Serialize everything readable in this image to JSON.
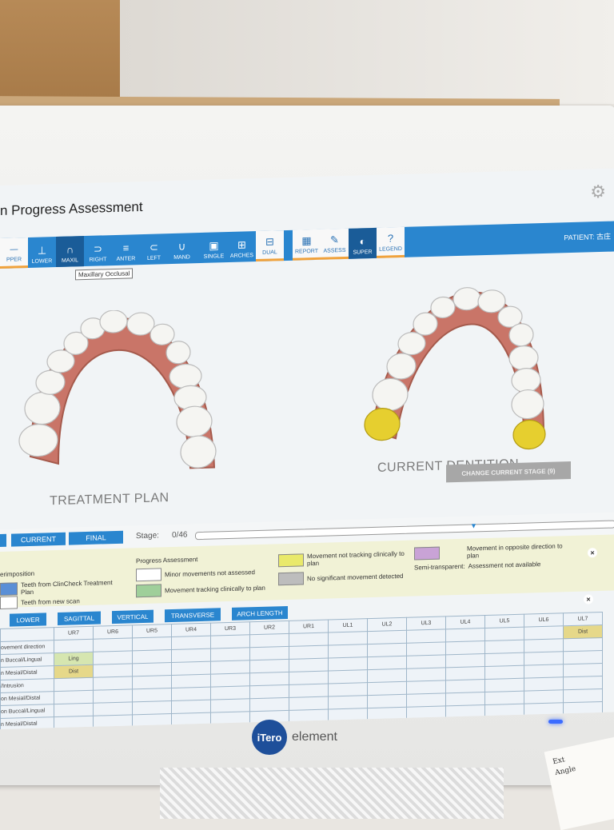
{
  "app": {
    "title": "n Progress Assessment",
    "patient_label": "PATIENT: 古庄",
    "tooltip": "Maxillary Occlusal"
  },
  "toolbar": {
    "view_buttons": [
      {
        "label": "PPER",
        "icon": "upper-icon"
      },
      {
        "label": "LOWER",
        "icon": "lower-icon"
      },
      {
        "label": "MAXIL",
        "icon": "maxil-icon"
      },
      {
        "label": "RIGHT",
        "icon": "right-icon"
      },
      {
        "label": "ANTER",
        "icon": "anterior-icon"
      },
      {
        "label": "LEFT",
        "icon": "left-icon"
      },
      {
        "label": "MAND",
        "icon": "mand-icon"
      }
    ],
    "layout_buttons": [
      {
        "label": "SINGLE",
        "icon": "single-icon"
      },
      {
        "label": "ARCHES",
        "icon": "arches-icon"
      }
    ],
    "dual_label": "DUAL",
    "tool_buttons": [
      {
        "label": "REPORT",
        "icon": "report-icon"
      },
      {
        "label": "ASSESS",
        "icon": "assess-icon"
      },
      {
        "label": "SUPER",
        "icon": "super-icon"
      },
      {
        "label": "LEGEND",
        "icon": "legend-icon"
      }
    ]
  },
  "viewer": {
    "left_label": "TREATMENT PLAN",
    "right_label": "CURRENT DENTITION",
    "change_stage_label": "CHANGE CURRENT STAGE (9)"
  },
  "timeline": {
    "current_label": "CURRENT",
    "final_label": "FINAL",
    "stage_label": "Stage:",
    "stage_value": "0/46"
  },
  "legend": {
    "superimposition_title": "erimposition",
    "teeth_clincheck": "Teeth from ClinCheck Treatment Plan",
    "teeth_new_scan": "Teeth from new scan",
    "progress_title": "Progress Assessment",
    "minor_movements": "Minor movements not assessed",
    "tracking": "Movement tracking clinically to plan",
    "not_tracking": "Movement not tracking clinically to plan",
    "no_significant": "No significant movement detected",
    "opposite": "Movement in opposite direction to plan",
    "semi_transparent": "Semi-transparent:",
    "not_available": "Assessment not available",
    "colors": {
      "clincheck": "#5a8fd6",
      "new_scan": "#ffffff",
      "minor": "#ffffff",
      "tracking": "#9fcf9a",
      "not_tracking": "#e9e96a",
      "no_significant": "#bdbdbd",
      "opposite": "#c9a3d6"
    }
  },
  "table": {
    "tabs": [
      "LOWER",
      "SAGITTAL",
      "VERTICAL",
      "TRANSVERSE",
      "ARCH LENGTH"
    ],
    "columns": [
      "UR7",
      "UR6",
      "UR5",
      "UR4",
      "UR3",
      "UR2",
      "UR1",
      "UL1",
      "UL2",
      "UL3",
      "UL4",
      "UL5",
      "UL6",
      "UL7"
    ],
    "rows": [
      {
        "label": "ovement direction",
        "cells": [
          "",
          "",
          "",
          "",
          "",
          "",
          "",
          "",
          "",
          "",
          "",
          "",
          "",
          "Dist"
        ]
      },
      {
        "label": "n Buccal/Lingual",
        "cells": [
          "Ling",
          "",
          "",
          "",
          "",
          "",
          "",
          "",
          "",
          "",
          "",
          "",
          "",
          ""
        ]
      },
      {
        "label": "n Mesial/Distal",
        "cells": [
          "Dist",
          "",
          "",
          "",
          "",
          "",
          "",
          "",
          "",
          "",
          "",
          "",
          "",
          ""
        ]
      },
      {
        "label": "/Intrusion",
        "cells": [
          "",
          "",
          "",
          "",
          "",
          "",
          "",
          "",
          "",
          "",
          "",
          "",
          "",
          ""
        ]
      },
      {
        "label": "on Mesial/Distal",
        "cells": [
          "",
          "",
          "",
          "",
          "",
          "",
          "",
          "",
          "",
          "",
          "",
          "",
          "",
          ""
        ]
      },
      {
        "label": "on Buccal/Lingual",
        "cells": [
          "",
          "",
          "",
          "",
          "",
          "",
          "",
          "",
          "",
          "",
          "",
          "",
          "",
          ""
        ]
      },
      {
        "label": "n Mesial/Distal",
        "cells": [
          "",
          "",
          "",
          "",
          "",
          "",
          "",
          "",
          "",
          "",
          "",
          "",
          "",
          ""
        ]
      }
    ]
  },
  "device": {
    "brand_logo": "iTero",
    "brand_name": "element"
  },
  "note": {
    "lines": [
      "Ext",
      "Angle"
    ]
  }
}
